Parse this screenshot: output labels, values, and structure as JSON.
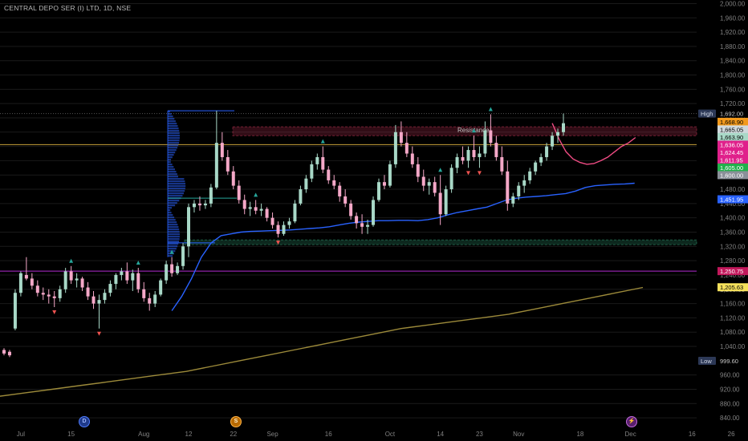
{
  "header": {
    "title": "CENTRAL DEPO SER (I) LTD, 1D, NSE"
  },
  "events": {
    "dividend": "D",
    "split": "S",
    "earnings": "⚡"
  },
  "chart_data": {
    "type": "candlestick",
    "ylim": [
      820,
      2010
    ],
    "y_ticks": [
      840,
      880,
      920,
      960,
      1040,
      1080,
      1120,
      1160,
      1200,
      1240,
      1280,
      1320,
      1360,
      1400,
      1440,
      1480,
      1520,
      1560,
      1600,
      1640,
      1680,
      1720,
      1760,
      1800,
      1840,
      1880,
      1920,
      1960,
      2000
    ],
    "y_tick_labels": [
      "840.00",
      "880.00",
      "920.00",
      "960.00",
      "1,040.00",
      "1,080.00",
      "1,120.00",
      "1,160.00",
      "1,200.00",
      "1,240.00",
      "1,280.00",
      "1,320.00",
      "1,360.00",
      "1,400.00",
      "1,440.00",
      "1,480.00",
      "1,520.00",
      "1,560.00",
      "1,600.00",
      "1,640.00",
      "1,680.00",
      "1,720.00",
      "1,760.00",
      "1,800.00",
      "1,840.00",
      "1,880.00",
      "1,920.00",
      "1,960.00",
      "2,000.00"
    ],
    "x_labels": [
      {
        "label": "Jul",
        "i": 3
      },
      {
        "label": "15",
        "i": 12
      },
      {
        "label": "Aug",
        "i": 25
      },
      {
        "label": "12",
        "i": 33
      },
      {
        "label": "22",
        "i": 41
      },
      {
        "label": "Sep",
        "i": 48
      },
      {
        "label": "16",
        "i": 58
      },
      {
        "label": "Oct",
        "i": 69
      },
      {
        "label": "14",
        "i": 78
      },
      {
        "label": "23",
        "i": 85
      },
      {
        "label": "Nov",
        "i": 92
      },
      {
        "label": "18",
        "i": 103
      },
      {
        "label": "Dec",
        "i": 112
      },
      {
        "label": "16",
        "i": 123
      },
      {
        "label": "26",
        "i": 130
      }
    ],
    "candles": [
      [
        1030,
        1035,
        1015,
        1020
      ],
      [
        1025,
        1030,
        1010,
        1015
      ],
      [
        1090,
        1200,
        1085,
        1190
      ],
      [
        1190,
        1250,
        1180,
        1245
      ],
      [
        1240,
        1290,
        1225,
        1230
      ],
      [
        1230,
        1245,
        1200,
        1210
      ],
      [
        1210,
        1225,
        1180,
        1190
      ],
      [
        1190,
        1205,
        1170,
        1185
      ],
      [
        1185,
        1200,
        1160,
        1180
      ],
      [
        1180,
        1195,
        1150,
        1175
      ],
      [
        1175,
        1210,
        1165,
        1200
      ],
      [
        1200,
        1260,
        1190,
        1250
      ],
      [
        1250,
        1265,
        1215,
        1225
      ],
      [
        1225,
        1245,
        1205,
        1230
      ],
      [
        1230,
        1235,
        1195,
        1205
      ],
      [
        1205,
        1220,
        1170,
        1180
      ],
      [
        1180,
        1195,
        1145,
        1160
      ],
      [
        1160,
        1185,
        1090,
        1170
      ],
      [
        1170,
        1200,
        1160,
        1190
      ],
      [
        1190,
        1225,
        1180,
        1215
      ],
      [
        1215,
        1245,
        1200,
        1240
      ],
      [
        1240,
        1260,
        1225,
        1250
      ],
      [
        1250,
        1275,
        1215,
        1225
      ],
      [
        1225,
        1255,
        1195,
        1245
      ],
      [
        1245,
        1260,
        1190,
        1200
      ],
      [
        1200,
        1220,
        1165,
        1175
      ],
      [
        1175,
        1190,
        1140,
        1160
      ],
      [
        1160,
        1195,
        1150,
        1185
      ],
      [
        1185,
        1230,
        1180,
        1225
      ],
      [
        1225,
        1280,
        1215,
        1270
      ],
      [
        1270,
        1290,
        1235,
        1245
      ],
      [
        1245,
        1275,
        1240,
        1265
      ],
      [
        1265,
        1330,
        1255,
        1320
      ],
      [
        1320,
        1440,
        1290,
        1430
      ],
      [
        1430,
        1450,
        1415,
        1440
      ],
      [
        1440,
        1460,
        1420,
        1435
      ],
      [
        1435,
        1450,
        1425,
        1440
      ],
      [
        1440,
        1495,
        1430,
        1485
      ],
      [
        1485,
        1700,
        1480,
        1610
      ],
      [
        1610,
        1640,
        1560,
        1570
      ],
      [
        1570,
        1590,
        1520,
        1530
      ],
      [
        1530,
        1545,
        1480,
        1490
      ],
      [
        1490,
        1505,
        1440,
        1450
      ],
      [
        1450,
        1465,
        1410,
        1425
      ],
      [
        1425,
        1445,
        1405,
        1430
      ],
      [
        1430,
        1450,
        1410,
        1420
      ],
      [
        1420,
        1440,
        1405,
        1425
      ],
      [
        1425,
        1430,
        1390,
        1400
      ],
      [
        1400,
        1415,
        1370,
        1380
      ],
      [
        1380,
        1390,
        1345,
        1355
      ],
      [
        1355,
        1390,
        1350,
        1380
      ],
      [
        1380,
        1400,
        1370,
        1390
      ],
      [
        1390,
        1450,
        1385,
        1440
      ],
      [
        1440,
        1490,
        1435,
        1480
      ],
      [
        1480,
        1520,
        1470,
        1510
      ],
      [
        1510,
        1560,
        1500,
        1550
      ],
      [
        1550,
        1580,
        1535,
        1570
      ],
      [
        1570,
        1600,
        1525,
        1535
      ],
      [
        1535,
        1545,
        1495,
        1505
      ],
      [
        1505,
        1520,
        1480,
        1490
      ],
      [
        1490,
        1500,
        1445,
        1460
      ],
      [
        1460,
        1480,
        1430,
        1440
      ],
      [
        1440,
        1450,
        1395,
        1405
      ],
      [
        1405,
        1415,
        1370,
        1385
      ],
      [
        1385,
        1410,
        1355,
        1375
      ],
      [
        1375,
        1395,
        1355,
        1380
      ],
      [
        1380,
        1460,
        1375,
        1450
      ],
      [
        1450,
        1510,
        1445,
        1500
      ],
      [
        1500,
        1520,
        1480,
        1490
      ],
      [
        1490,
        1560,
        1485,
        1550
      ],
      [
        1550,
        1660,
        1540,
        1640
      ],
      [
        1640,
        1670,
        1600,
        1610
      ],
      [
        1610,
        1640,
        1570,
        1580
      ],
      [
        1580,
        1600,
        1540,
        1550
      ],
      [
        1550,
        1570,
        1500,
        1515
      ],
      [
        1515,
        1535,
        1475,
        1490
      ],
      [
        1490,
        1510,
        1465,
        1500
      ],
      [
        1500,
        1515,
        1460,
        1470
      ],
      [
        1470,
        1520,
        1380,
        1410
      ],
      [
        1410,
        1490,
        1405,
        1480
      ],
      [
        1480,
        1550,
        1470,
        1540
      ],
      [
        1540,
        1580,
        1525,
        1570
      ],
      [
        1570,
        1600,
        1550,
        1560
      ],
      [
        1560,
        1600,
        1540,
        1590
      ],
      [
        1590,
        1630,
        1560,
        1570
      ],
      [
        1570,
        1600,
        1540,
        1580
      ],
      [
        1580,
        1670,
        1570,
        1645
      ],
      [
        1645,
        1690,
        1600,
        1610
      ],
      [
        1610,
        1630,
        1560,
        1570
      ],
      [
        1570,
        1600,
        1520,
        1530
      ],
      [
        1530,
        1560,
        1420,
        1440
      ],
      [
        1440,
        1470,
        1430,
        1460
      ],
      [
        1460,
        1500,
        1450,
        1490
      ],
      [
        1490,
        1520,
        1470,
        1505
      ],
      [
        1505,
        1540,
        1495,
        1530
      ],
      [
        1530,
        1560,
        1520,
        1555
      ],
      [
        1555,
        1580,
        1545,
        1570
      ],
      [
        1570,
        1610,
        1560,
        1600
      ],
      [
        1600,
        1640,
        1590,
        1630
      ],
      [
        1630,
        1650,
        1610,
        1640
      ],
      [
        1640,
        1692,
        1630,
        1665
      ]
    ],
    "ma_blue": [
      1140,
      1180,
      1230,
      1290,
      1330,
      1350,
      1355,
      1360,
      1362,
      1363,
      1364,
      1365,
      1366,
      1368,
      1370,
      1372,
      1375,
      1380,
      1385,
      1388,
      1390,
      1392,
      1392,
      1393,
      1393,
      1392,
      1395,
      1400,
      1408,
      1415,
      1420,
      1425,
      1430,
      1440,
      1450,
      1455,
      1458,
      1460,
      1462,
      1465,
      1468,
      1475,
      1485,
      1490,
      1492,
      1494,
      1495,
      1497
    ],
    "ma_pink": [
      1665,
      1620,
      1585,
      1565,
      1555,
      1550,
      1552,
      1560,
      1570,
      1585,
      1600,
      1610,
      1625
    ],
    "ma_gold": [
      900,
      910,
      920,
      930,
      940,
      950,
      960,
      970,
      985,
      1000,
      1015,
      1030,
      1045,
      1060,
      1075,
      1090,
      1100,
      1110,
      1120,
      1130,
      1145,
      1160,
      1175,
      1190,
      1205
    ],
    "h_lines": [
      {
        "value": 1692,
        "color": "#555555",
        "dashed": true
      },
      {
        "value": 1605,
        "color": "#c7a03a",
        "dashed": false
      },
      {
        "value": 1250.75,
        "color": "#b02bd0",
        "dashed": false
      }
    ],
    "zones": [
      {
        "label": "Resistance",
        "top": 1655,
        "bottom": 1630,
        "color": "#b0304f"
      },
      {
        "label": "",
        "top": 1338,
        "bottom": 1325,
        "color": "#2f8f6b"
      }
    ],
    "price_labels": [
      {
        "text": "High",
        "value": 1692,
        "bg": "#2c3856",
        "fg": "#d5dbe8",
        "kind": "tag"
      },
      {
        "text": "1,692.00",
        "value": 1692,
        "bg": "#000000",
        "fg": "#c8c8c8"
      },
      {
        "text": "1,668.90",
        "value": 1668.9,
        "bg": "#f2991c",
        "fg": "#000000"
      },
      {
        "text": "1,665.05",
        "value": 1665.05,
        "bg": "#cfd8dc",
        "fg": "#000000"
      },
      {
        "text": "1,663.90",
        "value": 1663.9,
        "bg": "#a8d8c7",
        "fg": "#000000"
      },
      {
        "text": "1,636.05",
        "value": 1636.05,
        "bg": "#e0208b",
        "fg": "#ffffff"
      },
      {
        "text": "1,624.45",
        "value": 1624.45,
        "bg": "#e0208b",
        "fg": "#ffffff"
      },
      {
        "text": "1,611.95",
        "value": 1611.95,
        "bg": "#e0208b",
        "fg": "#ffffff"
      },
      {
        "text": "1,605.00",
        "value": 1605,
        "bg": "#21b04b",
        "fg": "#ffffff"
      },
      {
        "text": "1,600.00",
        "value": 1600,
        "bg": "#8a9099",
        "fg": "#ffffff"
      },
      {
        "text": "1,451.95",
        "value": 1451.95,
        "bg": "#2962ff",
        "fg": "#ffffff"
      },
      {
        "text": "1,250.75",
        "value": 1250.75,
        "bg": "#c2185b",
        "fg": "#ffffff"
      },
      {
        "text": "1,205.63",
        "value": 1205.63,
        "bg": "#f7e25c",
        "fg": "#000000"
      },
      {
        "text": "Low",
        "value": 999.6,
        "bg": "#2c3856",
        "fg": "#d5dbe8",
        "kind": "tag"
      },
      {
        "text": "999.60",
        "value": 999.6,
        "bg": "#000000",
        "fg": "#c8c8c8"
      }
    ],
    "colors": {
      "up": "#a8d8c7",
      "down": "#f5a8c8",
      "blue": "#2962ff",
      "pink": "#f04c84",
      "gold": "#9c8a3a",
      "axis": "#808080",
      "grid": "#1a1a1a",
      "up_marker": "#26a69a",
      "down_marker": "#ef5350"
    }
  }
}
